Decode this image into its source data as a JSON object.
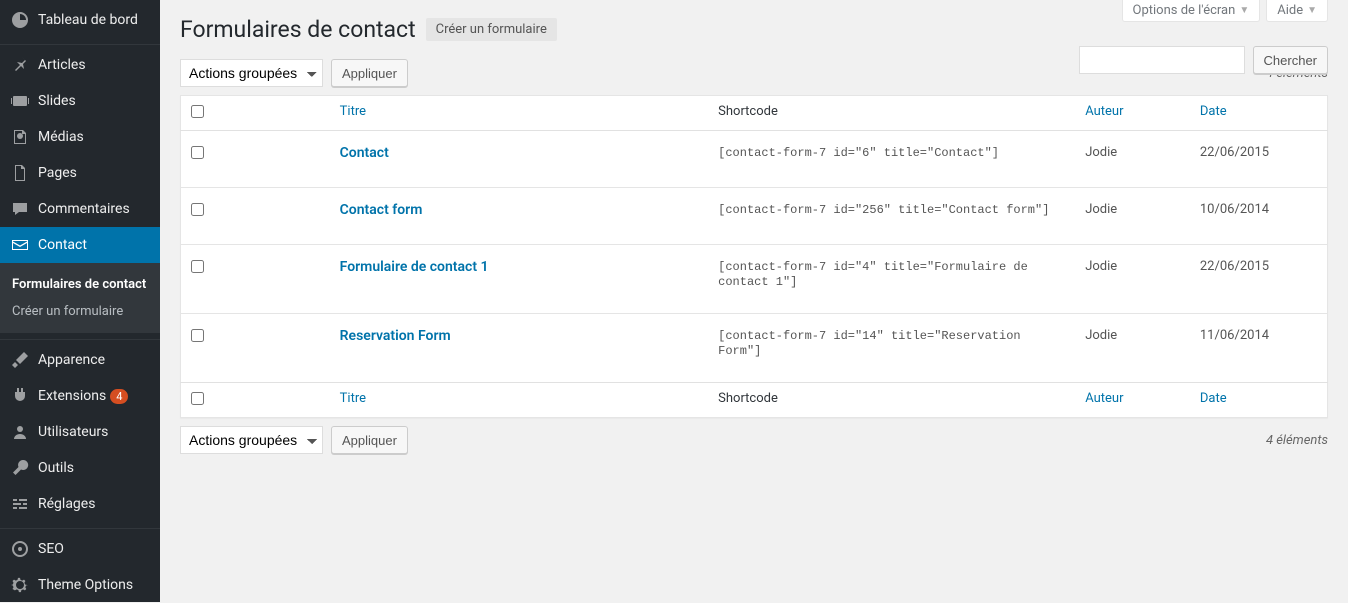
{
  "sidebar": {
    "items": [
      {
        "label": "Tableau de bord"
      },
      {
        "label": "Articles"
      },
      {
        "label": "Slides"
      },
      {
        "label": "Médias"
      },
      {
        "label": "Pages"
      },
      {
        "label": "Commentaires"
      },
      {
        "label": "Contact"
      },
      {
        "label": "Apparence"
      },
      {
        "label": "Extensions"
      },
      {
        "label": "Utilisateurs"
      },
      {
        "label": "Outils"
      },
      {
        "label": "Réglages"
      },
      {
        "label": "SEO"
      },
      {
        "label": "Theme Options"
      }
    ],
    "extensions_badge": "4",
    "submenu": {
      "forms": "Formulaires de contact",
      "create": "Créer un formulaire"
    }
  },
  "screen_meta": {
    "options": "Options de l'écran",
    "help": "Aide"
  },
  "header": {
    "title": "Formulaires de contact",
    "create_button": "Créer un formulaire"
  },
  "search": {
    "button": "Chercher"
  },
  "bulk": {
    "label": "Actions groupées",
    "apply": "Appliquer"
  },
  "count_text": "4 éléments",
  "columns": {
    "title": "Titre",
    "shortcode": "Shortcode",
    "author": "Auteur",
    "date": "Date"
  },
  "rows": [
    {
      "title": "Contact",
      "shortcode": "[contact-form-7 id=\"6\" title=\"Contact\"]",
      "author": "Jodie",
      "date": "22/06/2015"
    },
    {
      "title": "Contact form",
      "shortcode": "[contact-form-7 id=\"256\" title=\"Contact form\"]",
      "author": "Jodie",
      "date": "10/06/2014"
    },
    {
      "title": "Formulaire de contact 1",
      "shortcode": "[contact-form-7 id=\"4\" title=\"Formulaire de contact 1\"]",
      "author": "Jodie",
      "date": "22/06/2015"
    },
    {
      "title": "Reservation Form",
      "shortcode": "[contact-form-7 id=\"14\" title=\"Reservation Form\"]",
      "author": "Jodie",
      "date": "11/06/2014"
    }
  ]
}
